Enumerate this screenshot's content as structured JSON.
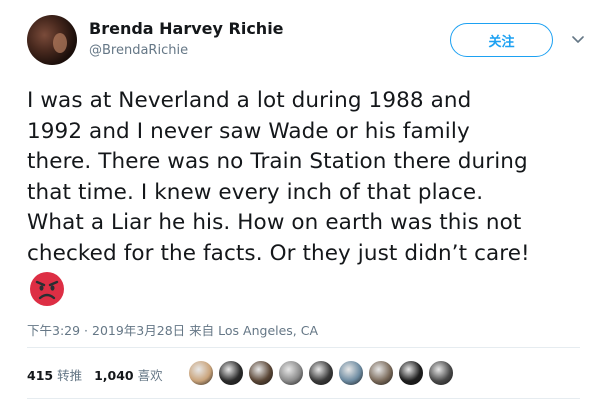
{
  "user": {
    "name": "Brenda Harvey Richie",
    "handle": "@BrendaRichie"
  },
  "follow_label": "关注",
  "tweet_lines": [
    "I was at Neverland a lot during 1988 and",
    "1992 and I never saw Wade or his family",
    "there. There was no Train Station there during",
    "that time. I knew every inch of that place.",
    "What a Liar he his. How on earth was this not",
    "checked for the facts. Or they just didn’t care!"
  ],
  "emoji": "angry-face",
  "meta": {
    "time": "下午3:29",
    "date": "2019年3月28日",
    "from_label": "来自",
    "location": "Los Angeles, CA"
  },
  "stats": {
    "retweets": "415",
    "retweets_label": "转推",
    "likes": "1,040",
    "likes_label": "喜欢"
  },
  "liker_colors": [
    "#c9a37a",
    "#2b2b2b",
    "#5a4636",
    "#8a8a8a",
    "#3a3a3a",
    "#6c8aa0",
    "#7a6a5a",
    "#1e1e1e",
    "#4a4a4a"
  ],
  "colors": {
    "accent": "#1da1f2",
    "secondary_text": "#657786"
  }
}
